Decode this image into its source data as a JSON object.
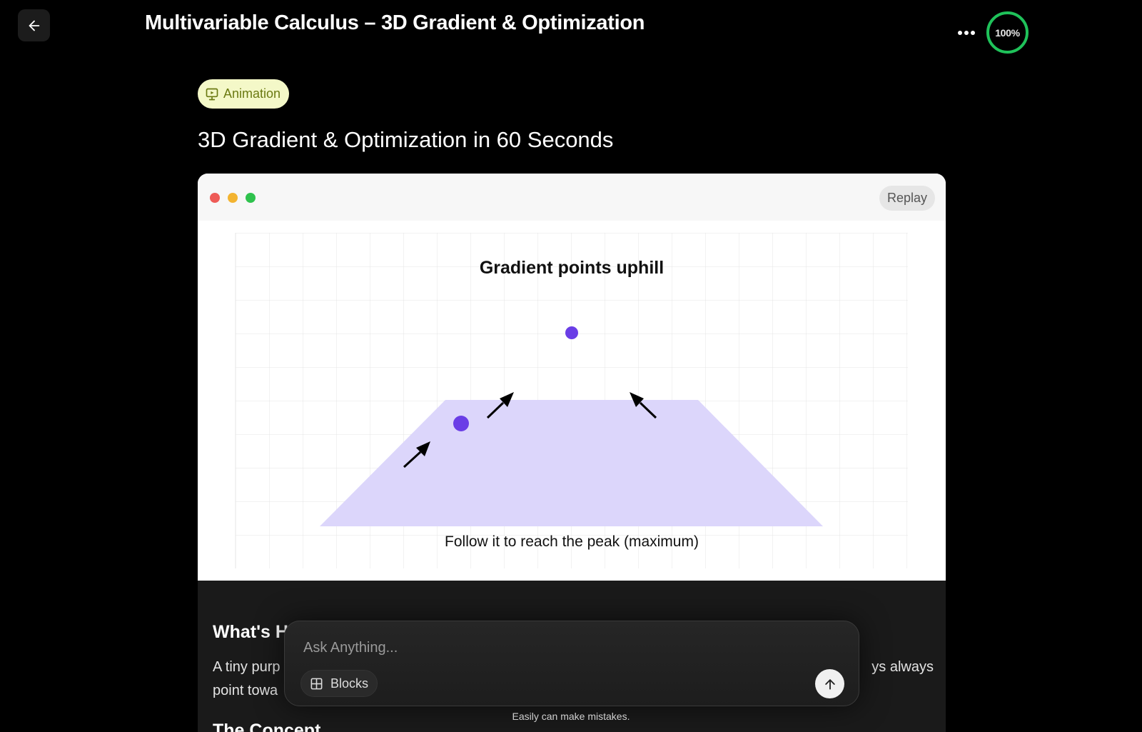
{
  "header": {
    "title": "Multivariable Calculus – 3D Gradient & Optimization",
    "progress": "100%",
    "progress_value": 1.0
  },
  "block": {
    "tag_label": "Animation",
    "title": "3D Gradient & Optimization in 60 Seconds"
  },
  "animation": {
    "replay_label": "Replay",
    "heading": "Gradient points uphill",
    "caption": "Follow it to reach the peak (maximum)",
    "colors": {
      "surface": "#dcd6fb",
      "point": "#6a3ee6",
      "arrow": "#000000"
    }
  },
  "content": {
    "heading": "What's H",
    "paragraph_line1_left": "A tiny purp",
    "paragraph_line1_right": "ys always",
    "paragraph_line2": "point towa",
    "next_heading": "The Concept"
  },
  "chat": {
    "placeholder": "Ask Anything...",
    "blocks_label": "Blocks",
    "disclaimer": "Easily can make mistakes."
  },
  "icons": {
    "back": "arrow-left-icon",
    "more": "more-horizontal-icon",
    "tag": "presentation-icon",
    "blocks": "grid-icon",
    "send": "arrow-up-icon"
  }
}
